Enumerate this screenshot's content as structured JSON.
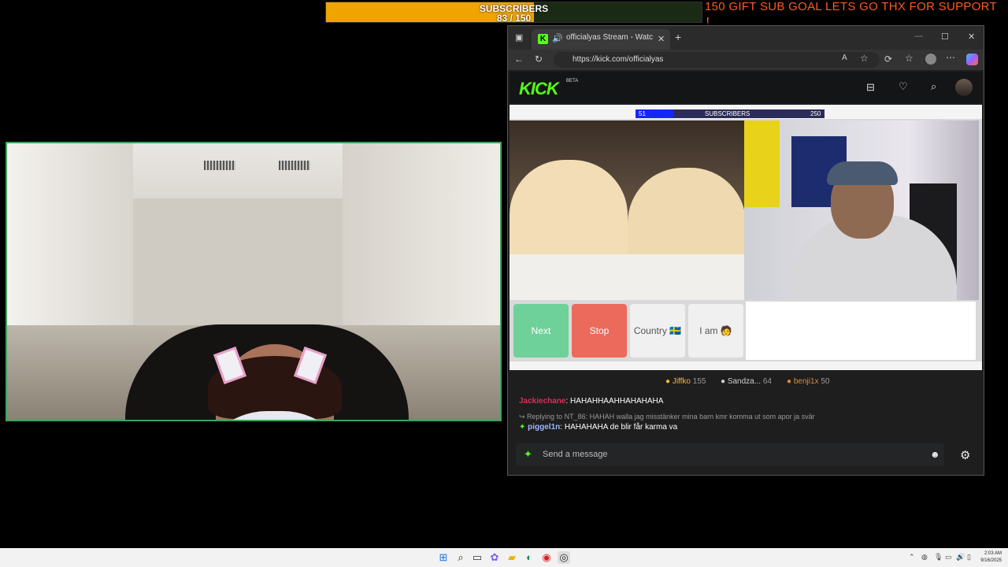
{
  "overlay": {
    "subscribers_label": "SUBSCRIBERS",
    "subscribers_count": "83 / 150",
    "subscribers_progress": 0.553,
    "goal_text": "150 GIFT SUB GOAL LETS GO THX FOR SUPPORT ！"
  },
  "browser": {
    "tab_title": "officialyas Stream - Watch Li",
    "url": "https://kick.com/officialyas",
    "new_tab": "+",
    "tab_close": "✕",
    "minimize": "—",
    "maximize": "☐",
    "close": "✕"
  },
  "kick": {
    "logo": "KICK",
    "beta": "BETA",
    "inner_stream": {
      "sub_current": "51",
      "sub_label": "SUBSCRIBERS",
      "sub_goal": "250",
      "buttons": {
        "next": "Next",
        "stop": "Stop",
        "country": "Country 🇸🇪",
        "iam": "I am 🧑"
      }
    },
    "gifters": [
      {
        "name": "Jiffko",
        "count": "155",
        "color": "#f5b83a"
      },
      {
        "name": "Sandza...",
        "count": "64",
        "color": "#cfcfcf"
      },
      {
        "name": "benji1x",
        "count": "50",
        "color": "#e08a3c"
      }
    ],
    "chat": [
      {
        "user": "Jackiechane",
        "sep": ":",
        "text": " HAHAHHAAHHAHAHAHA",
        "color": "#d9305a"
      },
      {
        "reply": "Replying to NT_86: HAHAH walla jag misstänker mina barn kmr komma ut som apor ja svär"
      },
      {
        "user": "piggel1n",
        "sep": ":",
        "text": " HAHAHAHA de blir får karma va",
        "color": "#9fb6ff"
      }
    ],
    "message_placeholder": "Send a message"
  },
  "taskbar": {
    "time": "2:03 AM",
    "date": "9/16/2025"
  },
  "colors": {
    "kick_green": "#53fc18",
    "sub_orange": "#f0a400",
    "goal_text": "#ff5a1f",
    "webcam_border": "#3fa35a"
  }
}
